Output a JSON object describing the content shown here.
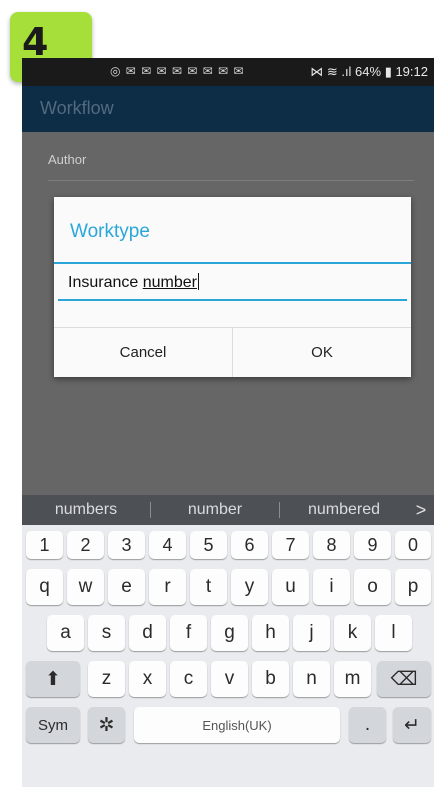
{
  "step_badge": {
    "number": "4"
  },
  "status_bar": {
    "notifications": "◎ ✉ ✉ ✉ ✉ ✉ ✉ ✉ ✉",
    "right": "⋈ ≋ .ıl 64% ▮ 19:12"
  },
  "app_bar": {
    "title": "Workflow"
  },
  "form": {
    "author_label": "Author"
  },
  "dialog": {
    "title": "Worktype",
    "input_prefix": "Insurance ",
    "input_underlined": "number",
    "cancel_label": "Cancel",
    "ok_label": "OK"
  },
  "keyboard": {
    "suggestions": [
      "numbers",
      "number",
      "numbered"
    ],
    "suggest_more": ">",
    "number_row": [
      "1",
      "2",
      "3",
      "4",
      "5",
      "6",
      "7",
      "8",
      "9",
      "0"
    ],
    "row1": [
      "q",
      "w",
      "e",
      "r",
      "t",
      "y",
      "u",
      "i",
      "o",
      "p"
    ],
    "row2": [
      "a",
      "s",
      "d",
      "f",
      "g",
      "h",
      "j",
      "k",
      "l"
    ],
    "row3": [
      "z",
      "x",
      "c",
      "v",
      "b",
      "n",
      "m"
    ],
    "shift_icon": "⬆",
    "backspace_icon": "⌫",
    "sym_label": "Sym",
    "settings_icon": "✲",
    "space_label": "English(UK)",
    "period_label": ".",
    "enter_icon": "↵"
  },
  "colors": {
    "accent": "#2aa7d8",
    "appbar": "#0d2c45",
    "badge": "#a7df3a"
  }
}
